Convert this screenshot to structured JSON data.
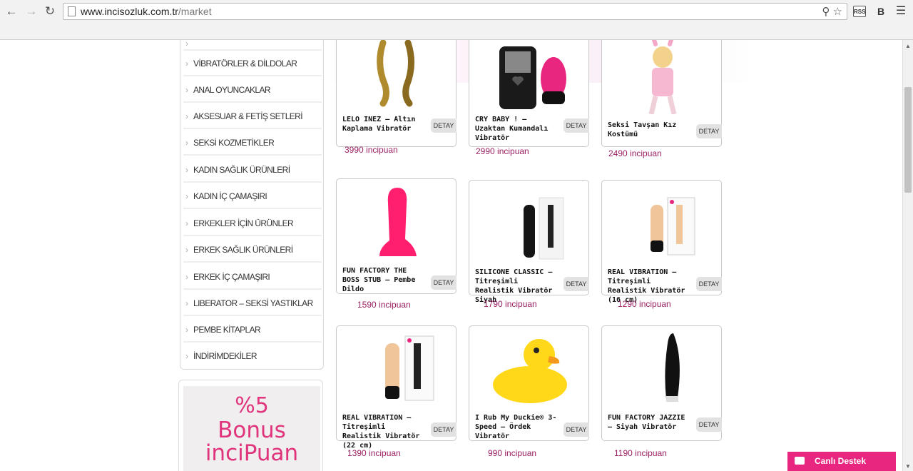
{
  "browser": {
    "url_host": "www.incisozluk.com.tr",
    "url_path": "/market"
  },
  "sidebar": {
    "categories": [
      "VİBRATÖRLER & DİLDOLAR",
      "ANAL OYUNCAKLAR",
      "AKSESUAR & FETİŞ SETLERİ",
      "SEKSİ KOZMETİKLER",
      "KADIN SAĞLIK ÜRÜNLERİ",
      "KADIN İÇ ÇAMAŞIRI",
      "ERKEKLER İÇİN ÜRÜNLER",
      "ERKEK SAĞLIK ÜRÜNLERİ",
      "ERKEK İÇ ÇAMAŞIRI",
      "LIBERATOR – SEKSİ YASTIKLAR",
      "PEMBE KİTAPLAR",
      "İNDİRİMDEKİLER"
    ]
  },
  "promo": {
    "line1": "%5",
    "line2": "Bonus",
    "line3": "inciPuan"
  },
  "detail_label": "DETAY",
  "products": [
    {
      "name": "LELO INEZ – Altın Kaplama Vibratör",
      "price": "3990 incipuan"
    },
    {
      "name": "CRY BABY ! – Uzaktan Kumandalı Vibratör",
      "price": "2990 incipuan"
    },
    {
      "name": "Seksi Tavşan Kız Kostümü",
      "price": "2490 incipuan"
    },
    {
      "name": "FUN FACTORY THE BOSS STUB – Pembe Dildo",
      "price": "1590 incipuan"
    },
    {
      "name": "SILICONE CLASSIC – Titreşimli Realistik Vibratör Siyah",
      "price": "1790 incipuan"
    },
    {
      "name": "REAL VIBRATION – Titreşimli Realistik Vibratör (16 cm)",
      "price": "1290 incipuan"
    },
    {
      "name": "REAL VIBRATION – Titreşimli Realistik Vibratör (22 cm)",
      "price": "1390 incipuan"
    },
    {
      "name": "I Rub My Duckie® 3-Speed – Ördek Vibratör",
      "price": "990 incipuan"
    },
    {
      "name": "FUN FACTORY JAZZIE – Siyah Vibratör",
      "price": "1190 incipuan"
    }
  ],
  "chat": {
    "label": "Canlı Destek",
    "icon": "chat-bubble-icon"
  }
}
